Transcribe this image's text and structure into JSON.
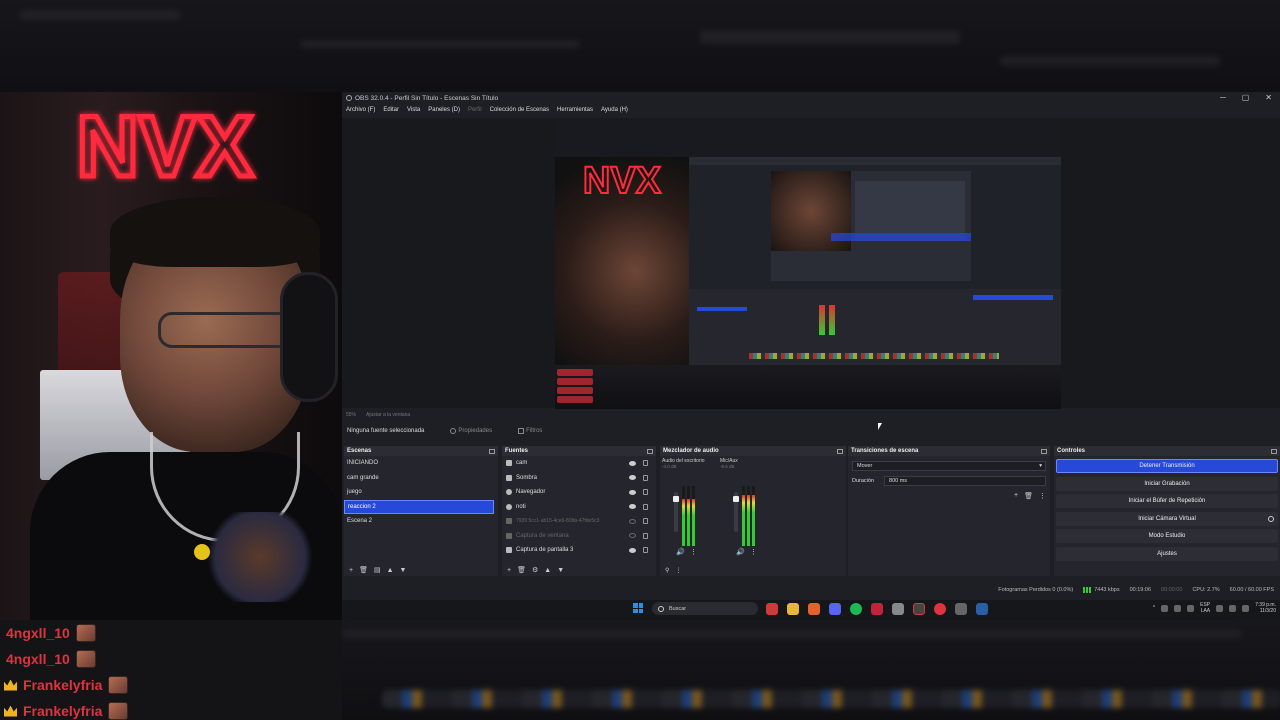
{
  "obs": {
    "window_title": "OBS 32.0.4 - Perfil Sin Título - Escenas Sin Título",
    "window_controls": [
      "─",
      "▢",
      "✕"
    ],
    "menu": [
      "Archivo (F)",
      "Editar",
      "Vista",
      "Paneles (D)",
      "Perfil",
      "Colección de Escenas",
      "Herramientas",
      "Ayuda (H)"
    ],
    "preview_toolbar": [
      "55%",
      "Ajustar a la ventana"
    ],
    "source_bar": {
      "selected_text": "Ninguna fuente seleccionada",
      "properties_label": "Propiedades",
      "filters_label": "Filtros"
    },
    "scenes": {
      "title": "Escenas",
      "items": [
        {
          "label": "INICIANDO",
          "selected": false
        },
        {
          "label": "cam grande",
          "selected": false
        },
        {
          "label": "juego",
          "selected": false
        },
        {
          "label": "reaccion 2",
          "selected": true
        },
        {
          "label": "Escena 2",
          "selected": false
        }
      ]
    },
    "sources": {
      "title": "Fuentes",
      "items": [
        {
          "label": "cam",
          "icon": "camera-icon",
          "dim": false
        },
        {
          "label": "Sombra",
          "icon": "brush-icon",
          "dim": false
        },
        {
          "label": "Navegador",
          "icon": "globe-icon",
          "dim": false
        },
        {
          "label": "noti",
          "icon": "globe-icon",
          "dim": false
        },
        {
          "label": "7939 5cc1-ab15-4ce6-80bb-47fde5c3",
          "icon": "image-icon",
          "dim": true
        },
        {
          "label": "Captura de ventana",
          "icon": "window-icon",
          "dim": true
        },
        {
          "label": "Captura de pantalla 3",
          "icon": "monitor-icon",
          "dim": false
        }
      ]
    },
    "mixer": {
      "title": "Mezclador de audio",
      "channels": [
        {
          "label": "Audio del escritorio",
          "db": "-4.0 dB",
          "level": 0.78
        },
        {
          "label": "Mic/Aux",
          "db": "-5.5 dB",
          "level": 0.85
        }
      ]
    },
    "transitions": {
      "title": "Transiciones de escena",
      "selected": "Mover",
      "duration_label": "Duración",
      "duration_value": "800 ms"
    },
    "controls": {
      "title": "Controles",
      "buttons": [
        {
          "label": "Detener Transmisión",
          "active": true
        },
        {
          "label": "Iniciar Grabación",
          "active": false
        },
        {
          "label": "Iniciar el Búfer de Repetición",
          "active": false
        },
        {
          "label": "Iniciar Cámara Virtual",
          "active": false
        },
        {
          "label": "Modo Estudio",
          "active": false
        },
        {
          "label": "Ajustes",
          "active": false
        }
      ]
    },
    "status": {
      "dropped": "Fotogramas Perdidos 0 (0.0%)",
      "bitrate": "7443 kbps",
      "live_time": "00:19:06",
      "rec_time": "00:00:00",
      "cpu": "CPU: 2.7%",
      "fps": "60.00 / 60.00 FPS"
    }
  },
  "taskbar": {
    "search_placeholder": "Buscar",
    "lang": "ESP",
    "lang2": "LAA",
    "time": "7:39 p.m.",
    "date": "11/3/20"
  },
  "chat": [
    {
      "user": "4ngxll_10",
      "badge": false
    },
    {
      "user": "4ngxll_10",
      "badge": false
    },
    {
      "user": "Frankelyfria",
      "badge": true
    },
    {
      "user": "Frankelyfria",
      "badge": true
    }
  ],
  "webcam": {
    "neon_text": "NVX"
  },
  "colors": {
    "accent_blue": "#2749d8",
    "neon_red": "#ff2b3c",
    "chat_name_red": "#e0323f",
    "obs_bg": "#1e1f25"
  }
}
